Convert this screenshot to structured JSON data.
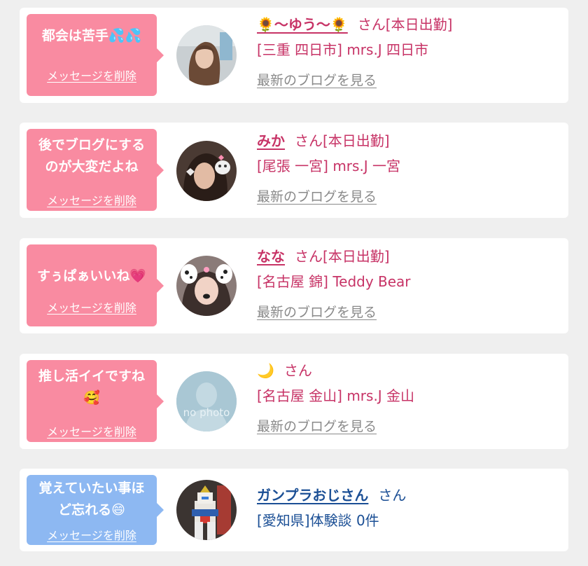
{
  "colors": {
    "page_bg": "#efefef",
    "card_bg": "#ffffff",
    "bubble_pink": "#f98ba1",
    "bubble_blue": "#8db8f2",
    "pink_text": "#c73366",
    "blue_text": "#1b4f95",
    "blog_link": "#8a8a8a"
  },
  "cards": [
    {
      "bubble_color": "pink",
      "message": "都会は苦手💦💦",
      "delete_label": "メッセージを削除",
      "name": "🌻～ゆう～🌻",
      "honorific": "さん[本日出勤]",
      "shop": "[三重 四日市] mrs.J 四日市",
      "blog_link": "最新のブログを見る"
    },
    {
      "bubble_color": "pink",
      "message": "後でブログにするのが大変だよね",
      "delete_label": "メッセージを削除",
      "name": "みか",
      "honorific": "さん[本日出勤]",
      "shop": "[尾張 一宮] mrs.J 一宮",
      "blog_link": "最新のブログを見る"
    },
    {
      "bubble_color": "pink",
      "message": "すぅぱぁいいね💗",
      "delete_label": "メッセージを削除",
      "name": "なな",
      "honorific": "さん[本日出勤]",
      "shop": "[名古屋 錦] Teddy Bear",
      "blog_link": "最新のブログを見る"
    },
    {
      "bubble_color": "pink",
      "message": "推し活イイですね🥰",
      "delete_label": "メッセージを削除",
      "name": "🌙",
      "honorific": "さん",
      "shop": "[名古屋 金山] mrs.J 金山",
      "blog_link": "最新のブログを見る",
      "avatar_text": "no photo"
    },
    {
      "bubble_color": "blue",
      "message": "覚えていたい事ほど忘れる😄",
      "delete_label": "メッセージを削除",
      "name": "ガンプラおじさん",
      "honorific": "さん",
      "shop": "[愛知県]体験談 0件"
    }
  ]
}
